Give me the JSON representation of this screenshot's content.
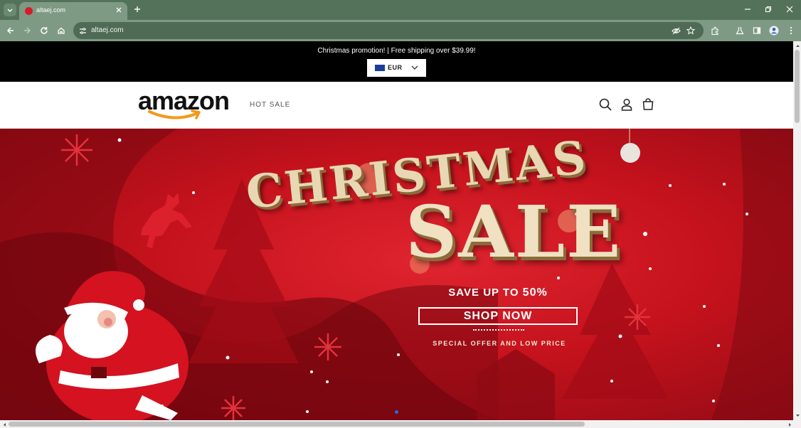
{
  "browser": {
    "tab_title": "altaej.com",
    "url": "altaej.com"
  },
  "announcement": {
    "text": "Christmas promotion! | Free shipping over $39.99!"
  },
  "currency": {
    "selected": "EUR"
  },
  "header": {
    "logo_text": "amazon",
    "nav_hot_sale": "HOT SALE"
  },
  "hero": {
    "title_line1": "CHRISTMAS",
    "title_line2": "SALE",
    "save_prefix": "SAVE UP TO ",
    "save_value": "50%",
    "cta_label": "SHOP NOW",
    "tagline": "SPECIAL OFFER AND LOW PRICE"
  },
  "colors": {
    "browser_frame": "#54725a",
    "announcement_bg": "#000000",
    "hero_red": "#c5121d",
    "logo_smile": "#f29a1a"
  },
  "icons": [
    "tab-search-icon",
    "close-icon",
    "new-tab-icon",
    "minimize-icon",
    "restore-icon",
    "back-icon",
    "forward-icon",
    "reload-icon",
    "home-icon",
    "site-info-icon",
    "eye-off-icon",
    "star-icon",
    "extensions-icon",
    "lab-icon",
    "sidebar-icon",
    "profile-icon",
    "more-icon",
    "search-icon",
    "account-icon",
    "cart-icon",
    "chevron-down-icon"
  ]
}
